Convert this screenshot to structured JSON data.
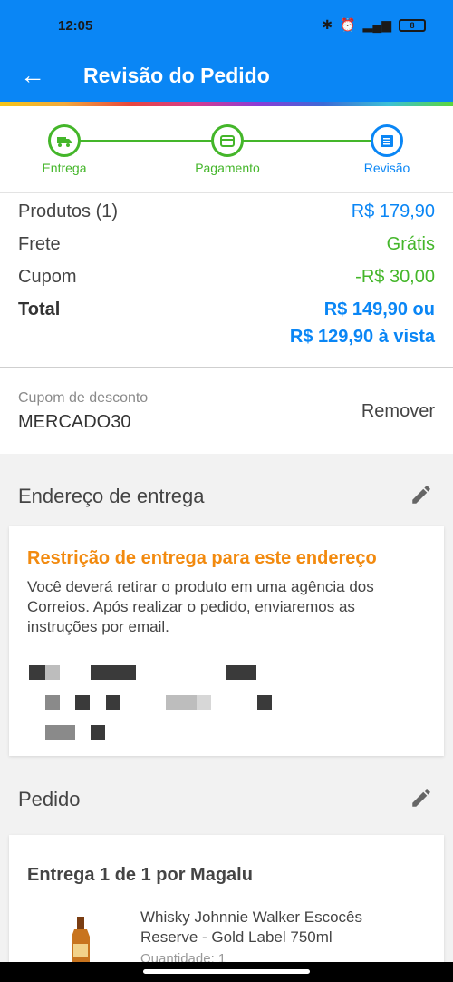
{
  "status_bar": {
    "time": "12:05",
    "battery": "8"
  },
  "app_bar": {
    "back_icon": "arrow-left-icon",
    "title": "Revisão do Pedido"
  },
  "stepper": {
    "steps": [
      {
        "label": "Entrega",
        "icon": "truck-icon",
        "state": "done"
      },
      {
        "label": "Pagamento",
        "icon": "card-icon",
        "state": "done"
      },
      {
        "label": "Revisão",
        "icon": "list-icon",
        "state": "current"
      }
    ]
  },
  "summary": {
    "products_label": "Produtos (1)",
    "products_value": "R$ 179,90",
    "shipping_label": "Frete",
    "shipping_value": "Grátis",
    "coupon_label": "Cupom",
    "coupon_value": "-R$ 30,00",
    "total_label": "Total",
    "total_value_1": "R$ 149,90 ou",
    "total_value_2": "R$ 129,90 à vista"
  },
  "coupon": {
    "caption": "Cupom de desconto",
    "code": "MERCADO30",
    "remove_label": "Remover"
  },
  "address": {
    "section_title": "Endereço de entrega",
    "restriction_title": "Restrição de entrega para este endereço",
    "restriction_text": "Você deverá retirar o produto em uma agência dos Correios. Após realizar o pedido, enviaremos as instruções por email."
  },
  "order": {
    "section_title": "Pedido",
    "delivery_title": "Entrega 1 de 1 por Magalu",
    "product_name": "Whisky Johnnie Walker Escocês Reserve - Gold Label 750ml",
    "product_qty": "Quantidade: 1"
  },
  "colors": {
    "primary": "#0a86f5",
    "success": "#44b62a",
    "warning": "#f28a0f"
  }
}
